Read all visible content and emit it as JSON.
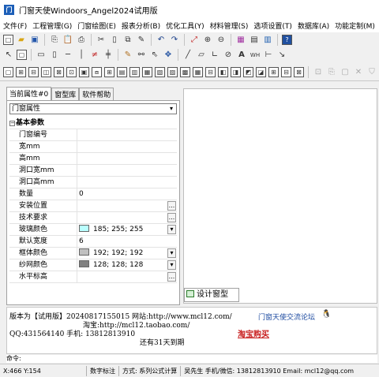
{
  "window": {
    "title": "门窗天使Windoors_Angel2024试用版",
    "logo_text": "门"
  },
  "menu": [
    "文件(F)",
    "工程管理(G)",
    "门窗绘图(E)",
    "报表分析(B)",
    "优化工具(Y)",
    "材料管理(S)",
    "选项设置(T)",
    "数据库(A)",
    "功能定制(M)",
    "帮助"
  ],
  "toolbar1": [
    "new-file-icon",
    "folder-icon",
    "save-icon",
    "copy-icon",
    "paste-icon",
    "print-icon",
    "cut-icon",
    "page-icon",
    "duplicate-icon",
    "pen-icon",
    "undo-icon",
    "redo-icon",
    "chart-icon",
    "zoom-in-icon",
    "zoom-out-icon",
    "grid-icon",
    "table-icon",
    "book-icon",
    "help-icon"
  ],
  "toolbar2": [
    "pointer-icon",
    "frame-icon",
    "horizontal-bar-icon",
    "bar-icon",
    "hline-icon",
    "vline-icon",
    "break-icon",
    "ladder-icon",
    "pencil-icon",
    "link-icon",
    "move-icon",
    "move-cross-icon",
    "line-icon",
    "rect-icon",
    "corner-icon",
    "circle-icon",
    "text-icon",
    "wh-icon",
    "dimension-icon",
    "arrow-icon"
  ],
  "toolbar3_count": 24,
  "toolbar3_dim": [
    "align-icon",
    "copy-grey-icon",
    "paste-grey-icon",
    "delete-grey-icon",
    "filter-icon",
    "node-icon",
    "flow-icon",
    "diagram-icon"
  ],
  "left_panel": {
    "tabs": [
      "当前属性#0",
      "窗型库",
      "软件帮助"
    ],
    "select_value": "门窗属性",
    "category": "基本参数",
    "properties": [
      {
        "name": "门窗编号",
        "value": "",
        "color": "",
        "button": ""
      },
      {
        "name": "宽mm",
        "value": "",
        "color": "",
        "button": ""
      },
      {
        "name": "高mm",
        "value": "",
        "color": "",
        "button": ""
      },
      {
        "name": "洞口宽mm",
        "value": "",
        "color": "",
        "button": ""
      },
      {
        "name": "洞口高mm",
        "value": "",
        "color": "",
        "button": ""
      },
      {
        "name": "数量",
        "value": "0",
        "color": "",
        "button": ""
      },
      {
        "name": "安装位置",
        "value": "",
        "color": "",
        "button": "..."
      },
      {
        "name": "技术要求",
        "value": "",
        "color": "",
        "button": "..."
      },
      {
        "name": "玻璃颜色",
        "value": "185; 255; 255",
        "color": "#b9ffff",
        "button": "▾"
      },
      {
        "name": "默认宽度",
        "value": "6",
        "color": "",
        "button": ""
      },
      {
        "name": "框体颜色",
        "value": "192; 192; 192",
        "color": "#c0c0c0",
        "button": "▾"
      },
      {
        "name": "纱网颜色",
        "value": "128; 128; 128",
        "color": "#808080",
        "button": "▾"
      },
      {
        "name": "水平标高",
        "value": "",
        "color": "",
        "button": "..."
      }
    ]
  },
  "design_tab": "设计窗型",
  "info": {
    "version_line": "版本为【试用版】20240817155015  网站:http://www.mcl12.com/",
    "taobao_line": "淘宝:http://mcl12.taobao.com/",
    "contact_line": "QQ:431564140 手机: 13812813910",
    "days_left": "还有31天到期",
    "forum_link": "门窗天使交流论坛",
    "taobao_buy": "淘宝购买",
    "command_label": "命令:"
  },
  "statusbar": [
    "X:466  Y:154",
    "数字标注",
    "方式: 系列公式计算",
    "吴先生 手机/微信: 13812813910  Email: mcl12@qq.com"
  ]
}
